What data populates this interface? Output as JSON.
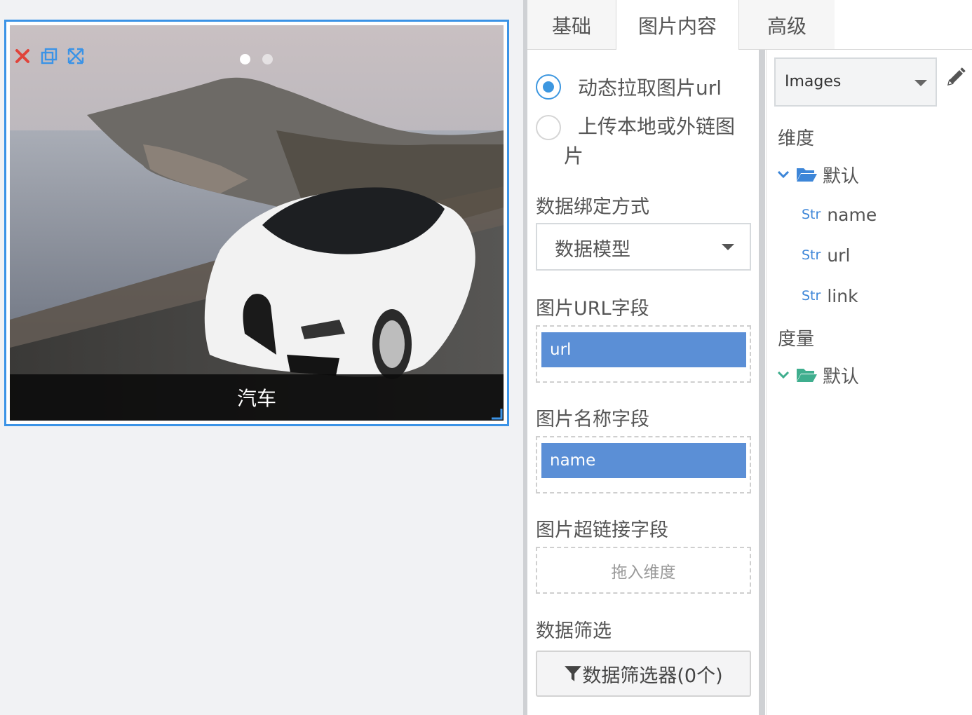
{
  "widget": {
    "caption": "汽车",
    "tools": [
      "close-icon",
      "copy-icon",
      "expand-icon"
    ],
    "carousel_dots": 2,
    "active_dot": 1
  },
  "tabs": [
    {
      "label": "基础",
      "active": false
    },
    {
      "label": "图片内容",
      "active": true
    },
    {
      "label": "高级",
      "active": false
    }
  ],
  "form": {
    "radio_dynamic": "动态拉取图片url",
    "radio_upload": "上传本地或外链图片",
    "selected_radio": "dynamic",
    "binding_label": "数据绑定方式",
    "binding_value": "数据模型",
    "url_field_label": "图片URL字段",
    "url_field_value": "url",
    "name_field_label": "图片名称字段",
    "name_field_value": "name",
    "link_field_label": "图片超链接字段",
    "link_field_placeholder": "拖入维度",
    "filter_label": "数据筛选",
    "filter_button": "数据筛选器(0个)"
  },
  "fields": {
    "dataset": "Images",
    "dimension_title": "维度",
    "dimension_folder": "默认",
    "dimension_fields": [
      {
        "type": "Str",
        "name": "name"
      },
      {
        "type": "Str",
        "name": "url"
      },
      {
        "type": "Str",
        "name": "link"
      }
    ],
    "measure_title": "度量",
    "measure_folder": "默认"
  },
  "colors": {
    "accent_blue": "#3b93e6",
    "chip_blue": "#5b8fd6",
    "close_red": "#e0443b",
    "measure_green": "#3fae8e"
  }
}
